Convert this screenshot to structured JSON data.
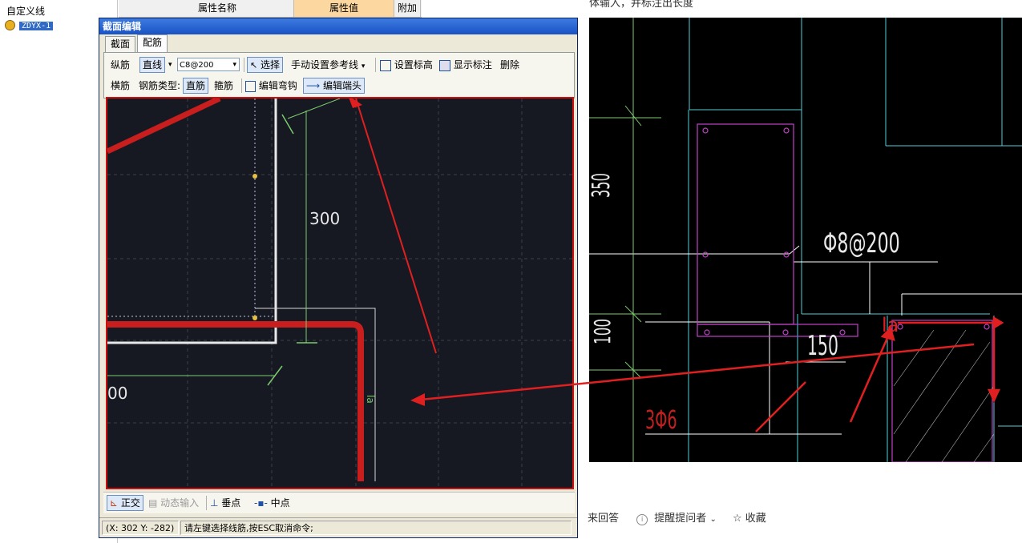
{
  "tree": {
    "item1": "自定义线",
    "item2": "ZDYX-1"
  },
  "prop_header": {
    "col1": "属性名称",
    "col2": "属性值",
    "col3": "附加"
  },
  "dialog": {
    "title": "截面编辑",
    "tabs": [
      "截面",
      "配筋"
    ],
    "row1": {
      "label": "纵筋",
      "mode_btn": "直线",
      "spec_value": "C8@200",
      "select_btn": "选择",
      "refline": "手动设置参考线",
      "set_elev": "设置标高",
      "show_dim": "显示标注",
      "delete": "删除"
    },
    "row2": {
      "label": "横筋",
      "type_label": "钢筋类型:",
      "straight_btn": "直筋",
      "stirrup": "箍筋",
      "edit_hook": "编辑弯钩",
      "edit_end": "编辑端头"
    },
    "canvas": {
      "dim_300": "300",
      "dim_00": "00",
      "label_la": "la"
    },
    "bottom": {
      "ortho": "正交",
      "dynamic": "动态输入",
      "perp": "垂点",
      "mid": "中点"
    },
    "status": {
      "coords": "(X: 302 Y: -282)",
      "message": "请左键选择线筋,按ESC取消命令;"
    }
  },
  "cad": {
    "dim_350": "350",
    "dim_100": "100",
    "rebar_spec": "Φ8@200",
    "dim_150": "150",
    "bars": "3Φ6",
    "la": "la"
  },
  "page": {
    "top_text": "体输入，并标注出长度",
    "answer": "来回答",
    "remind": "提醒提问者",
    "favorite": "收藏"
  },
  "colors": {
    "arrow": "#e02020",
    "canvas_bg": "#161922",
    "rebar": "#c81e1e",
    "dim_green": "#7ccc6e"
  }
}
